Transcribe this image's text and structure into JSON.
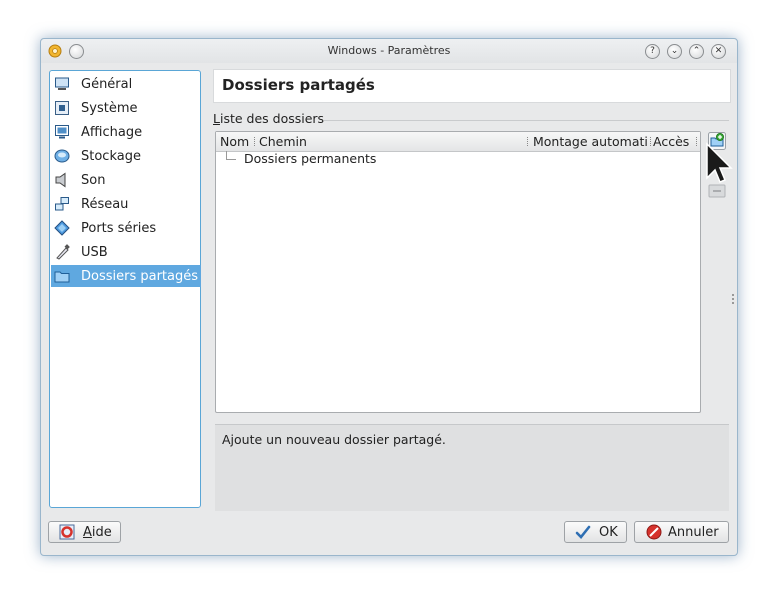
{
  "window": {
    "title": "Windows - Paramètres",
    "app_icon": "gear-icon",
    "controls": [
      "help-icon",
      "minimize-icon",
      "maximize-icon",
      "close-icon"
    ],
    "help_glyph": "?",
    "min_glyph": "⌄",
    "max_glyph": "⌃",
    "close_glyph": "✕"
  },
  "sidebar": {
    "items": [
      {
        "label": "Général",
        "icon": "monitor-icon"
      },
      {
        "label": "Système",
        "icon": "chip-icon"
      },
      {
        "label": "Affichage",
        "icon": "display-icon"
      },
      {
        "label": "Stockage",
        "icon": "disk-icon"
      },
      {
        "label": "Son",
        "icon": "speaker-icon"
      },
      {
        "label": "Réseau",
        "icon": "network-icon"
      },
      {
        "label": "Ports séries",
        "icon": "serial-port-icon"
      },
      {
        "label": "USB",
        "icon": "usb-icon"
      },
      {
        "label": "Dossiers partagés",
        "icon": "folder-icon",
        "selected": true
      }
    ]
  },
  "content": {
    "title": "Dossiers partagés",
    "group_label": "Liste des dossiers",
    "columns": [
      "Nom",
      "Chemin",
      "Montage automati",
      "Accès"
    ],
    "rows": [
      {
        "name": "Dossiers permanents"
      }
    ],
    "info_text": "Ajoute un nouveau dossier partagé."
  },
  "footer": {
    "help_label": "Aide",
    "ok_label": "OK",
    "cancel_label": "Annuler"
  },
  "colors": {
    "accent": "#5fa8e0",
    "window_bg": "#e8e9ea",
    "cancel_red": "#d6322c",
    "ok_blue": "#2f6fb3"
  }
}
